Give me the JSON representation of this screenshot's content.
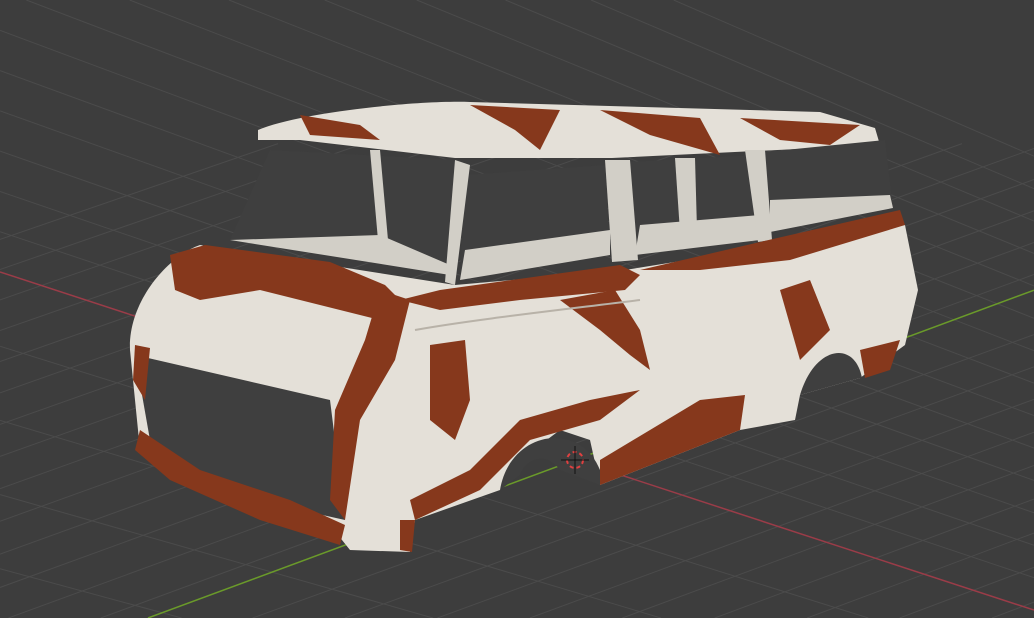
{
  "viewport": {
    "background_color": "#3d3d3d",
    "grid_color": "#4b4b4b",
    "x_axis_color": "#9a3c48",
    "y_axis_color": "#6a9a2a",
    "cursor_color": "#e04040"
  },
  "model": {
    "paint_color": "#e4e0d8",
    "shadow_paint_color": "#bdb8ae",
    "rust_color": "#86381c",
    "interior_color": "#d2cfc7",
    "window_opening_color": "#3f3f3f"
  }
}
